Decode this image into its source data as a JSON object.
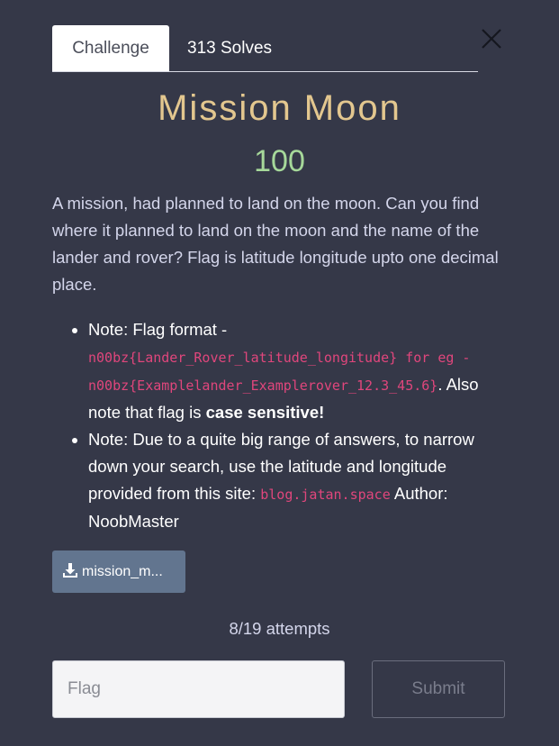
{
  "tabs": {
    "challenge_label": "Challenge",
    "solves_label": "313 Solves"
  },
  "challenge": {
    "title": "Mission Moon",
    "points": "100",
    "description": "A mission, had planned to land on the moon. Can you find where it planned to land on the moon and the name of the lander and rover? Flag is latitude longitude upto one decimal place.",
    "note1": {
      "prefix": "Note: Flag format -",
      "format_code": "n00bz{Lander_Rover_latitude_longitude} for eg - n00bz{Examplelander_Examplerover_12.3_45.6}",
      "middle": ". Also note that flag is ",
      "emphasis": "case sensitive!"
    },
    "note2": {
      "prefix": "Note: Due to a quite big range of answers, to narrow down your search, use the latitude and longitude provided from this site:",
      "site_code": "blog.jatan.space",
      "suffix": "Author: NoobMaster"
    }
  },
  "file": {
    "label": "mission_m...",
    "icon": "download-icon"
  },
  "attempts_text": "8/19 attempts",
  "flag_form": {
    "placeholder": "Flag",
    "submit_label": "Submit"
  },
  "colors": {
    "background": "#353848",
    "title": "#e3c78f",
    "points": "#a6d89a",
    "code": "#e0467c",
    "download_button": "#62758f"
  }
}
